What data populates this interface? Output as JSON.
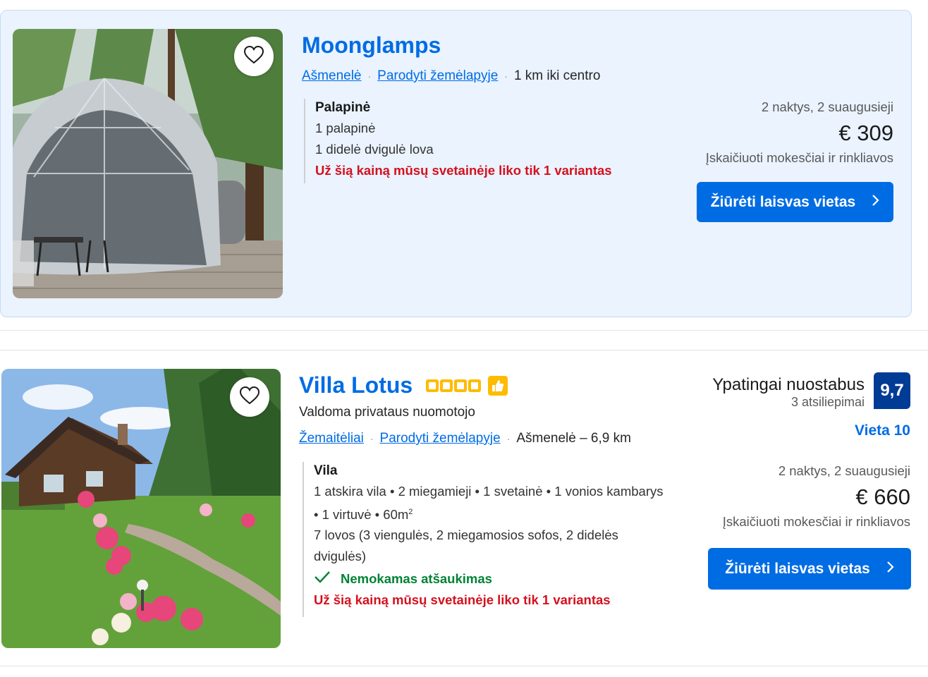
{
  "listings": [
    {
      "name": "Moonglamps",
      "town": "Ašmenelė",
      "map_link": "Parodyti žemėlapyje",
      "distance": "1 km iki centro",
      "unit_name": "Palapinė",
      "unit_lines": [
        "1 palapinė",
        "1 didelė dvigulė lova"
      ],
      "warning": "Už šią kainą mūsų svetainėje liko tik 1 variantas",
      "nights": "2 naktys, 2 suaugusieji",
      "price": "€ 309",
      "taxes": "Įskaičiuoti mokesčiai ir rinkliavos",
      "button": "Žiūrėti laisvas vietas",
      "image_icon": "heart-icon"
    },
    {
      "name": "Villa Lotus",
      "stars": 4,
      "managed_by": "Valdoma privataus nuomotojo",
      "town": "Žemaitėliai",
      "map_link": "Parodyti žemėlapyje",
      "distance": "Ašmenelė – 6,9 km",
      "unit_name": "Vila",
      "unit_line1": "1 atskira vila • 2 miegamieji • 1 svetainė • 1 vonios kambarys",
      "unit_line2": "• 1 virtuvė • 60m",
      "unit_line2_sup": "2",
      "unit_line3": "7 lovos (3 viengulės, 2 miegamosios sofos, 2 didelės",
      "unit_line4": "dvigulės)",
      "free_cancel": "Nemokamas atšaukimas",
      "warning": "Už šią kainą mūsų svetainėje liko tik 1 variantas",
      "score_word": "Ypatingai nuostabus",
      "reviews": "3 atsiliepimai",
      "score": "9,7",
      "location_score": "Vieta 10",
      "nights": "2 naktys, 2 suaugusieji",
      "price": "€ 660",
      "taxes": "Įskaičiuoti mokesčiai ir rinkliavos",
      "button": "Žiūrėti laisvas vietas"
    }
  ],
  "colors": {
    "brand_blue": "#006ce4",
    "dark_blue": "#003b95",
    "warning_red": "#d4111e",
    "success_green": "#008234",
    "star_yellow": "#febb02"
  }
}
